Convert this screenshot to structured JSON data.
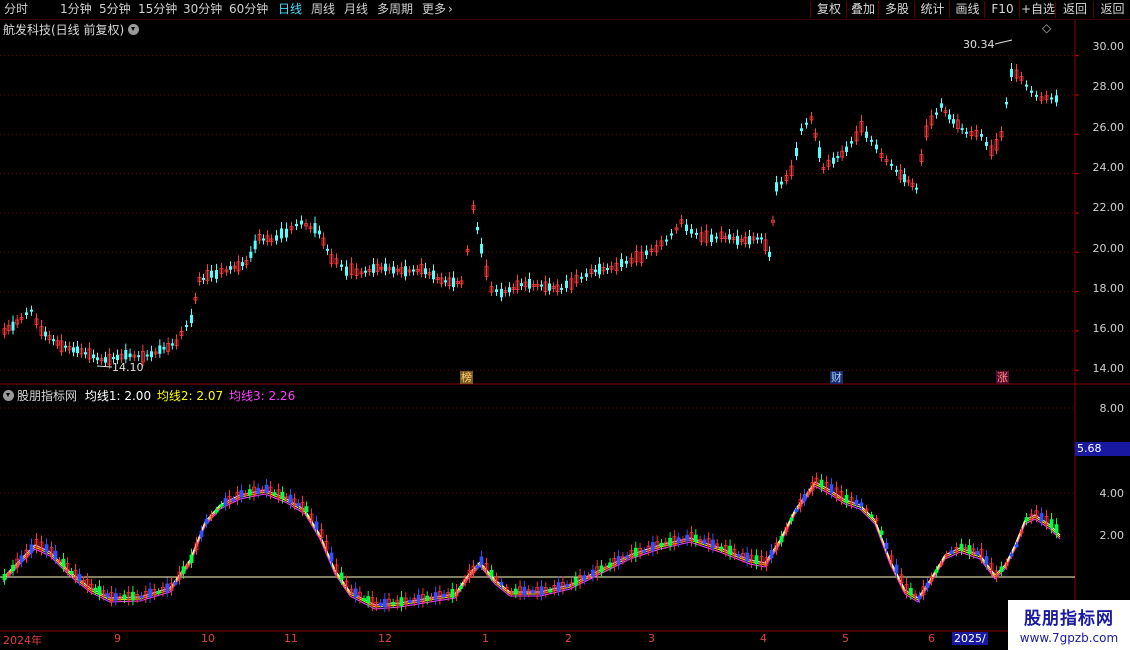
{
  "toolbar": {
    "periods": [
      "分时",
      "1分钟",
      "5分钟",
      "15分钟",
      "30分钟",
      "60分钟",
      "日线",
      "周线",
      "月线",
      "多周期",
      "更多"
    ],
    "active_period": "日线",
    "more_arrow": "›",
    "right_buttons": [
      "复权",
      "叠加",
      "多股",
      "统计",
      "画线",
      "F10",
      "+自选",
      "返回"
    ]
  },
  "main_chart": {
    "title": "航发科技(日线 前复权)",
    "menu_icon": "chevron-down-circle-icon",
    "diamond_icon": "◇",
    "high_label": "30.34",
    "low_label": "14.10",
    "price_ticks": [
      "30.00",
      "28.00",
      "26.00",
      "24.00",
      "22.00",
      "20.00",
      "18.00",
      "16.00",
      "14.00"
    ],
    "price_values": [
      30,
      28,
      26,
      24,
      22,
      20,
      18,
      16,
      14
    ],
    "price_range": [
      13.2,
      31.0
    ],
    "badges": {
      "list": "榜",
      "finance": "财",
      "limit": "涨"
    },
    "colors": {
      "up": "#ff3b3b",
      "down": "#54ffff",
      "grid": "#6a0000"
    }
  },
  "indicator": {
    "title": "股朋指标网",
    "ma1_label": "均线1:",
    "ma1_value": "2.00",
    "ma2_label": "均线2:",
    "ma2_value": "2.07",
    "ma3_label": "均线3:",
    "ma3_value": "2.26",
    "ticks": [
      "8.00",
      "4.00",
      "2.00"
    ],
    "tick_values": [
      8,
      4,
      2
    ],
    "current_value": "5.68",
    "colors": {
      "ma1": "#ffffff",
      "ma2": "#ffff00",
      "ma3": "#ff40ff"
    }
  },
  "x_axis": [
    "2024年",
    "9",
    "10",
    "11",
    "12",
    "1",
    "2",
    "3",
    "4",
    "5",
    "6",
    "2025/"
  ],
  "watermark": {
    "title": "股朋指标网",
    "url": "www.7gpzb.com"
  }
}
